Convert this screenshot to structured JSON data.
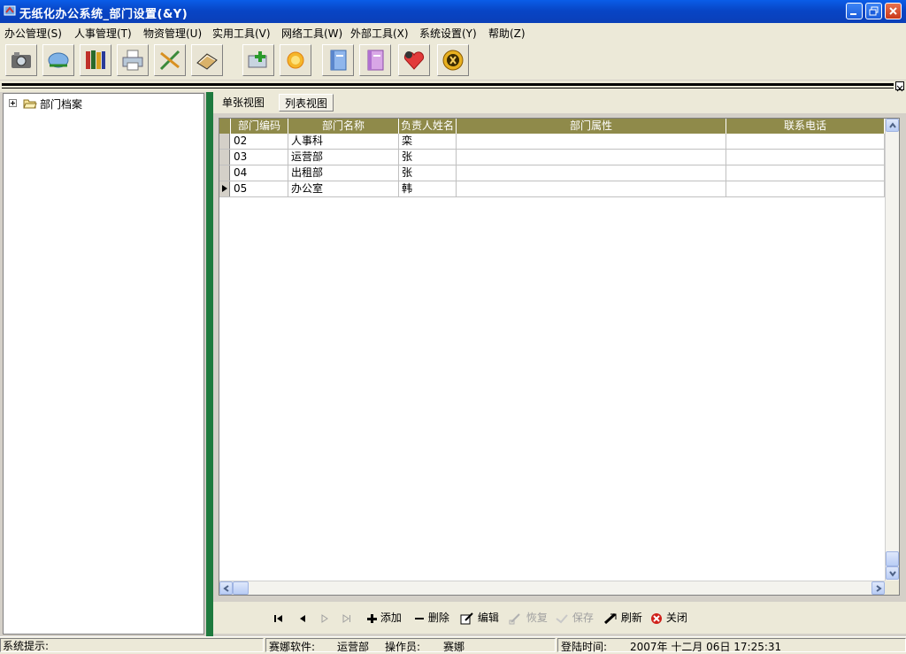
{
  "window": {
    "title": "无纸化办公系统_部门设置(&Y)"
  },
  "menu": [
    "办公管理(S)",
    "人事管理(T)",
    "物资管理(U)",
    "实用工具(V)",
    "网络工具(W)",
    "外部工具(X)",
    "系统设置(Y)",
    "帮助(Z)"
  ],
  "toolbar_icons": [
    "camera-icon",
    "network-icon",
    "books-icon",
    "printer-icon",
    "tools-icon",
    "scanner-icon",
    "add-card-icon",
    "sun-icon",
    "blue-notebook-icon",
    "purple-notebook-icon",
    "heart-icon",
    "exit-icon"
  ],
  "tree": {
    "root": "部门档案"
  },
  "tabs": [
    "单张视图",
    "列表视图"
  ],
  "grid": {
    "columns": [
      "部门编码",
      "部门名称",
      "负责人姓名",
      "部门属性",
      "联系电话"
    ],
    "rows": [
      [
        "02",
        "人事科",
        "栾",
        "",
        ""
      ],
      [
        "03",
        "运营部",
        "张",
        "",
        ""
      ],
      [
        "04",
        "出租部",
        "张",
        "",
        ""
      ],
      [
        "05",
        "办公室",
        "韩",
        "",
        ""
      ]
    ],
    "current_row": 3
  },
  "navbar": {
    "add": "添加",
    "delete": "删除",
    "edit": "编辑",
    "restore": "恢复",
    "save": "保存",
    "refresh": "刷新",
    "close": "关闭"
  },
  "status": {
    "hint_label": "系统提示:",
    "software_label": "赛娜软件:",
    "dept": "运营部",
    "operator_label": "操作员:",
    "operator": "赛娜",
    "login_label": "登陆时间:",
    "login_time": "2007年 十二月 06日 17:25:31"
  }
}
